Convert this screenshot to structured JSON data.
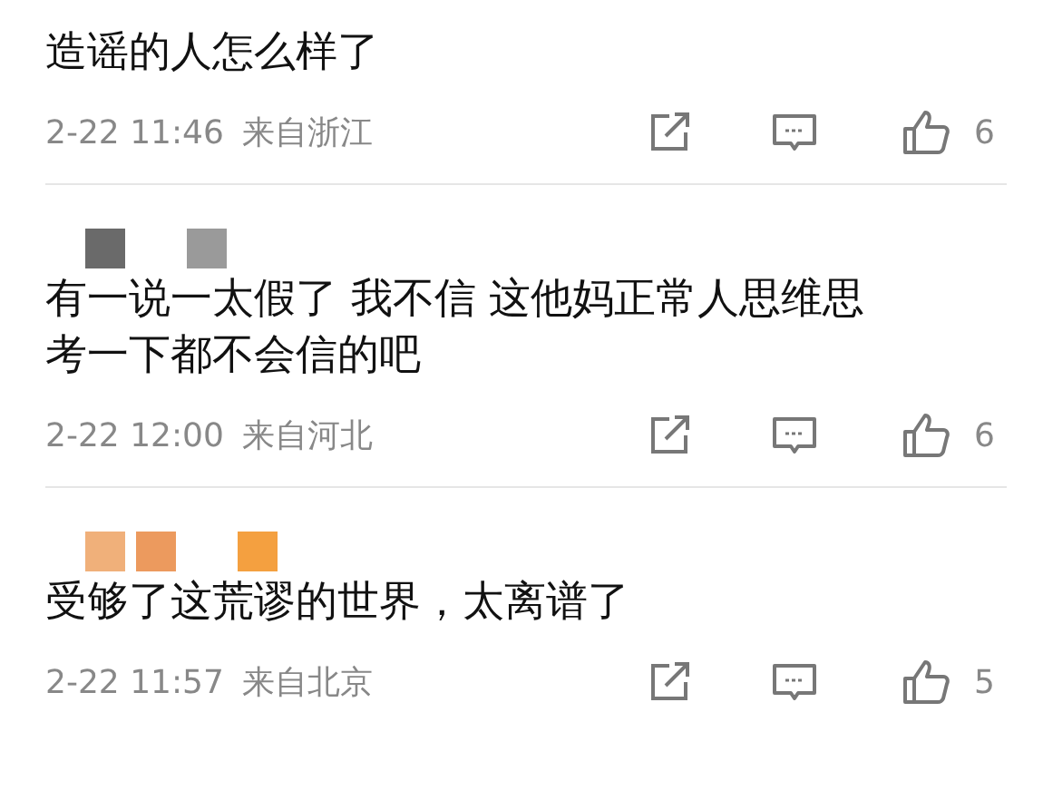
{
  "comments": [
    {
      "text": "造谣的人怎么样了",
      "time": "2-22 11:46",
      "location": "来自浙江",
      "likes": "6"
    },
    {
      "redacted_name": {
        "kind": "gray"
      },
      "text": "有一说一太假了 我不信 这他妈正常人思维思考一下都不会信的吧",
      "time": "2-22 12:00",
      "location": "来自河北",
      "likes": "6"
    },
    {
      "redacted_name": {
        "kind": "orange"
      },
      "text": "受够了这荒谬的世界，太离谱了",
      "time": "2-22 11:57",
      "location": "来自北京",
      "likes": "5"
    }
  ]
}
